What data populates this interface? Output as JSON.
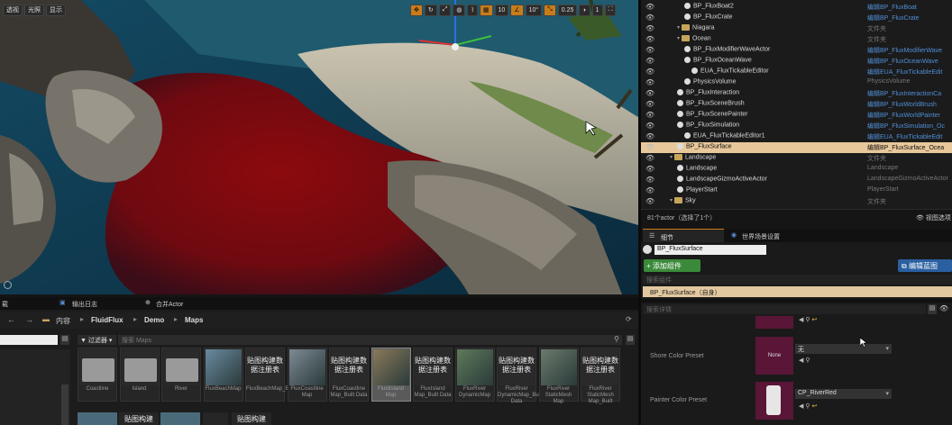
{
  "viewport": {
    "tb_left": [
      "透视",
      "光照",
      "显示"
    ],
    "grid_snap": "10",
    "angle_snap": "10°",
    "scale_snap": "0.25",
    "cam_speed": "1"
  },
  "outliner": {
    "rows": [
      {
        "name": "BP_FluxBoat2",
        "type": "编辑BP_FluxBoat",
        "indent": 4,
        "icon": "actor",
        "typeColor": "blue"
      },
      {
        "name": "BP_FluxCrate",
        "type": "编辑BP_FluxCrate",
        "indent": 4,
        "icon": "actor",
        "typeColor": "blue"
      },
      {
        "name": "Niagara",
        "type": "文件夹",
        "indent": 3,
        "icon": "folder",
        "typeColor": "gray"
      },
      {
        "name": "Ocean",
        "type": "文件夹",
        "indent": 3,
        "icon": "folder",
        "typeColor": "gray"
      },
      {
        "name": "BP_FluxModifierWaveActor",
        "type": "编辑BP_FluxModifierWave",
        "indent": 4,
        "icon": "actor",
        "typeColor": "blue"
      },
      {
        "name": "BP_FluxOceanWave",
        "type": "编辑BP_FluxOceanWave",
        "indent": 4,
        "icon": "actor",
        "typeColor": "blue"
      },
      {
        "name": "EUA_FluxTickableEditor",
        "type": "编辑EUA_FluxTickableEdit",
        "indent": 5,
        "icon": "actor",
        "typeColor": "blue"
      },
      {
        "name": "PhysicsVolume",
        "type": "PhysicsVolume",
        "indent": 4,
        "icon": "actor",
        "typeColor": "gray"
      },
      {
        "name": "BP_FluxInteraction",
        "type": "编辑BP_FluxInteractionCa",
        "indent": 3,
        "icon": "actor",
        "typeColor": "blue"
      },
      {
        "name": "BP_FluxSceneBrush",
        "type": "编辑BP_FluxWorldBrush",
        "indent": 3,
        "icon": "actor",
        "typeColor": "blue"
      },
      {
        "name": "BP_FluxScenePainter",
        "type": "编辑BP_FluxWorldPainter",
        "indent": 3,
        "icon": "actor",
        "typeColor": "blue"
      },
      {
        "name": "BP_FluxSimulation",
        "type": "编辑BP_FluxSimulation_Oc",
        "indent": 3,
        "icon": "actor",
        "typeColor": "blue"
      },
      {
        "name": "EUA_FluxTickableEditor1",
        "type": "编辑EUA_FluxTickableEdit",
        "indent": 4,
        "icon": "actor",
        "typeColor": "blue"
      },
      {
        "name": "BP_FluxSurface",
        "type": "编辑BP_FluxSurface_Ocea",
        "indent": 3,
        "icon": "actor",
        "typeColor": "blue",
        "selected": true
      },
      {
        "name": "Landscape",
        "type": "文件夹",
        "indent": 2,
        "icon": "folder",
        "typeColor": "gray"
      },
      {
        "name": "Landscape",
        "type": "Landscape",
        "indent": 3,
        "icon": "actor",
        "typeColor": "gray"
      },
      {
        "name": "LandscapeGizmoActiveActor",
        "type": "LandscapeGizmoActiveActor",
        "indent": 3,
        "icon": "actor",
        "typeColor": "gray"
      },
      {
        "name": "PlayerStart",
        "type": "PlayerStart",
        "indent": 3,
        "icon": "actor",
        "typeColor": "gray"
      },
      {
        "name": "Sky",
        "type": "文件夹",
        "indent": 2,
        "icon": "folder",
        "typeColor": "gray"
      }
    ],
    "status": "81个actor（选择了1个）",
    "view_options": "视图选项"
  },
  "details": {
    "tab_details": "细节",
    "tab_world": "世界场景设置",
    "actor_name": "BP_FluxSurface",
    "add_component": "+ 添加组件",
    "edit_blueprint": "编辑蓝图",
    "search_components": "搜索组件",
    "component_root": "BP_FluxSurface（自身）",
    "search_details": "搜索详情",
    "shore_label": "Shore Color Preset",
    "shore_value": "无",
    "shore_thumb": "None",
    "painter_label": "Painter Color Preset",
    "painter_value": "CP_RiverRed"
  },
  "bottom": {
    "tab1": "输出日志",
    "tab2": "合并Actor",
    "left_tab": "载",
    "crumbs": [
      "内容",
      "FluidFlux",
      "Demo",
      "Maps"
    ],
    "filter": "过滤器",
    "search_placeholder": "搜索 Maps",
    "assets": [
      {
        "caption": "Coastline",
        "kind": "folder"
      },
      {
        "caption": "Island",
        "kind": "folder"
      },
      {
        "caption": "River",
        "kind": "folder"
      },
      {
        "caption": "FluxBeachMap",
        "kind": "map",
        "color": "#6a8aa0"
      },
      {
        "caption": "FluxBeachMap_BuiltData",
        "kind": "data",
        "tag": "贴图构建数据注册表"
      },
      {
        "caption": "FluxCoastline Map",
        "kind": "map",
        "color": "#7d8a94"
      },
      {
        "caption": "FluxCoastline Map_Built Data",
        "kind": "data",
        "tag": "贴图构建数据注册表"
      },
      {
        "caption": "FluidIsland Map",
        "kind": "map",
        "color": "#8a7a5a",
        "selected": true
      },
      {
        "caption": "FluxIsland Map_Built Data",
        "kind": "data",
        "tag": "贴图构建数据注册表"
      },
      {
        "caption": "FluxRiver DynamicMap",
        "kind": "map",
        "color": "#5e7a5a"
      },
      {
        "caption": "FluxRiver DynamicMap_Built Data",
        "kind": "data",
        "tag": "贴图构建数据注册表"
      },
      {
        "caption": "FluxRiver StaticMesh Map",
        "kind": "map",
        "color": "#6a7a6a"
      },
      {
        "caption": "FluxRiver StaticMesh Map_Built",
        "kind": "data",
        "tag": "贴图构建数据注册表"
      }
    ],
    "row2_tags": [
      "贴图构建",
      "贴图构建"
    ]
  }
}
